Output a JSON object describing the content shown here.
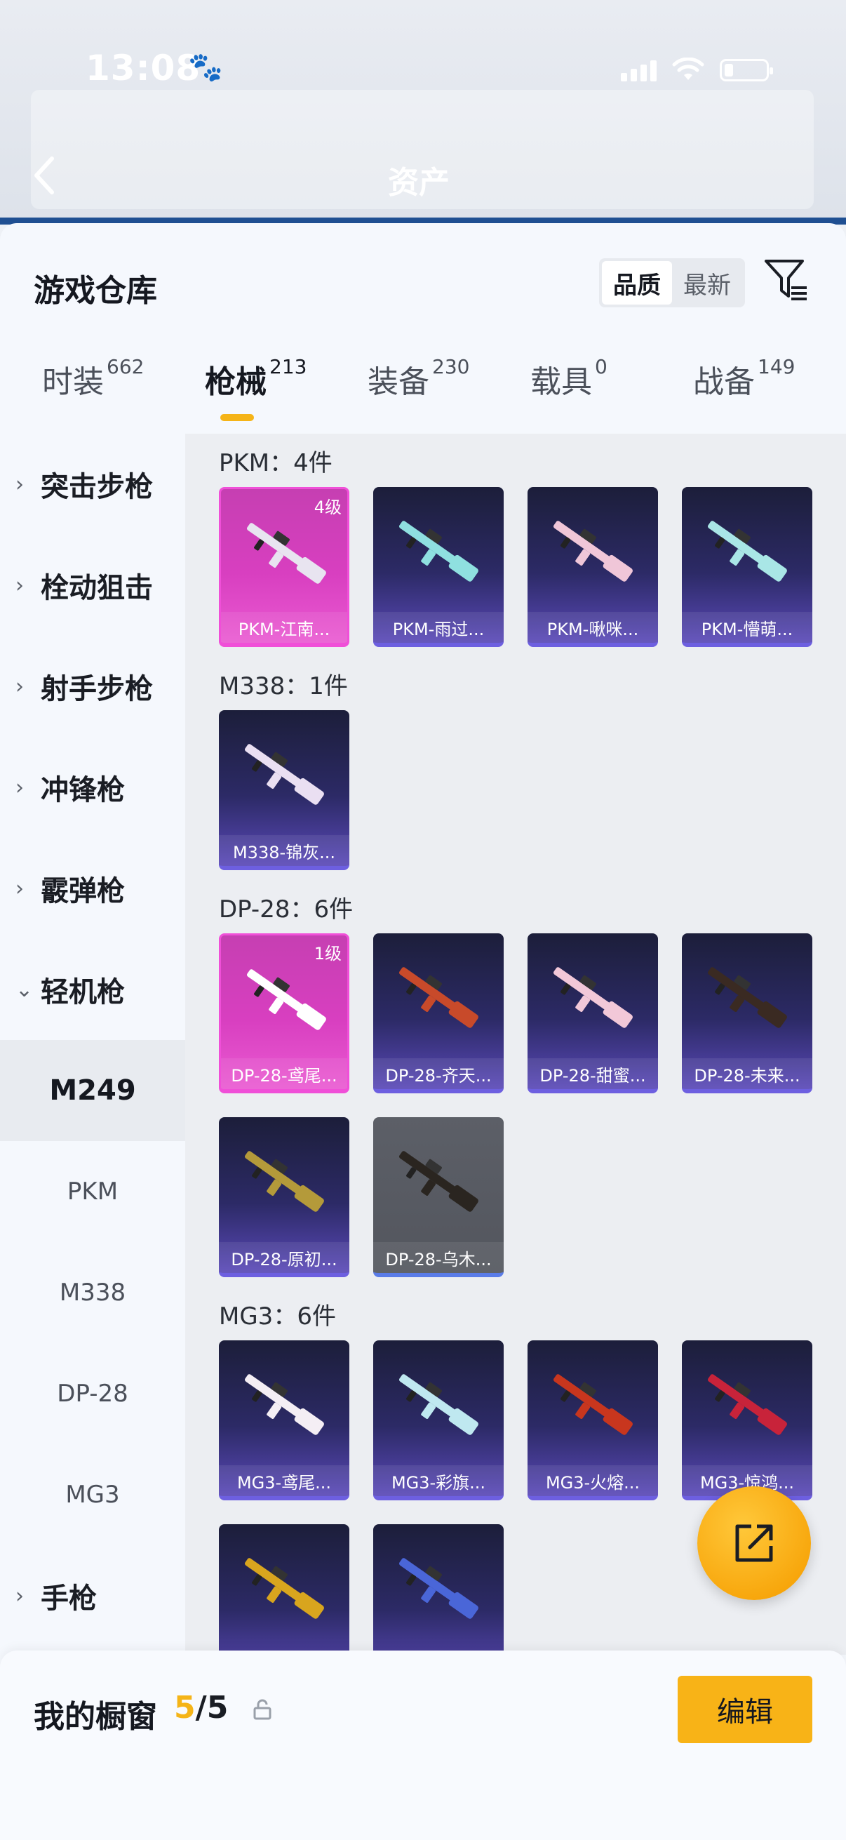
{
  "status_bar": {
    "time": "13:08"
  },
  "header": {
    "title": "资产"
  },
  "warehouse": {
    "title": "游戏仓库",
    "sort_options": [
      "品质",
      "最新"
    ],
    "sort_selected": "品质"
  },
  "tabs": [
    {
      "label": "时装",
      "count": "662"
    },
    {
      "label": "枪械",
      "count": "213",
      "active": true
    },
    {
      "label": "装备",
      "count": "230"
    },
    {
      "label": "载具",
      "count": "0"
    },
    {
      "label": "战备",
      "count": "149"
    }
  ],
  "sidebar": {
    "categories": [
      "突击步枪",
      "栓动狙击",
      "射手步枪",
      "冲锋枪",
      "霰弹枪",
      "轻机枪"
    ],
    "expanded": "轻机枪",
    "sub_items": [
      "M249",
      "PKM",
      "M338",
      "DP-28",
      "MG3"
    ],
    "sub_selected": "M249",
    "after": [
      "手枪"
    ]
  },
  "groups": [
    {
      "title": "PKM：4件",
      "items": [
        {
          "name": "PKM-江南...",
          "level": "4级",
          "rarity": "pink"
        },
        {
          "name": "PKM-雨过...",
          "rarity": "purple"
        },
        {
          "name": "PKM-啾咪...",
          "rarity": "purple"
        },
        {
          "name": "PKM-懵萌...",
          "rarity": "purple"
        }
      ]
    },
    {
      "title": "M338：1件",
      "items": [
        {
          "name": "M338-锦灰...",
          "rarity": "purple"
        }
      ]
    },
    {
      "title": "DP-28：6件",
      "items": [
        {
          "name": "DP-28-鸢尾...",
          "level": "1级",
          "rarity": "pink"
        },
        {
          "name": "DP-28-齐天...",
          "rarity": "purple"
        },
        {
          "name": "DP-28-甜蜜...",
          "rarity": "purple"
        },
        {
          "name": "DP-28-未来...",
          "rarity": "purple"
        },
        {
          "name": "DP-28-原初...",
          "rarity": "purple"
        },
        {
          "name": "DP-28-乌木...",
          "rarity": "gray"
        }
      ]
    },
    {
      "title": "MG3：6件",
      "items": [
        {
          "name": "MG3-鸢尾...",
          "rarity": "purple"
        },
        {
          "name": "MG3-彩旗...",
          "rarity": "purple"
        },
        {
          "name": "MG3-火熔...",
          "rarity": "purple"
        },
        {
          "name": "MG3-惊鸿...",
          "rarity": "purple"
        },
        {
          "name": "",
          "rarity": "purple"
        },
        {
          "name": "",
          "rarity": "purple"
        }
      ]
    }
  ],
  "showcase": {
    "label": "我的橱窗",
    "current": "5",
    "separator": "/",
    "total": "5",
    "edit_label": "编辑"
  },
  "colors": {
    "accent": "#f5b418",
    "rarity_pink": "#e54fcf",
    "rarity_purple": "#5a49b8",
    "rarity_gray": "#5c5f67"
  }
}
